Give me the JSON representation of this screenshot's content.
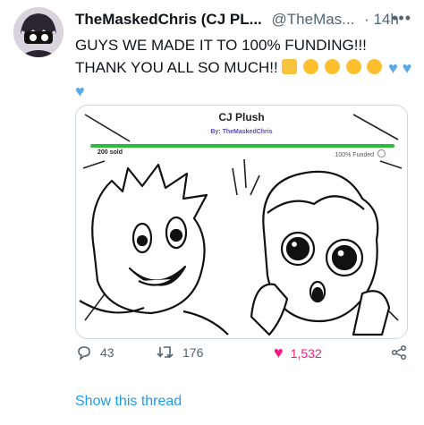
{
  "tweet": {
    "author_name": "TheMaskedChris (CJ PL...",
    "author_handle": "@TheMas...",
    "time": "· 14h",
    "line1": "GUYS WE MADE IT TO 100% FUNDING!!!",
    "line2": "THANK YOU ALL SO MUCH!!",
    "emojis": [
      "party-face",
      "loudly-crying-face",
      "loudly-crying-face",
      "loudly-crying-face",
      "pleading-face"
    ],
    "hearts_icon": "blue-heart-icon"
  },
  "media": {
    "title": "CJ Plush",
    "by": "By: TheMaskedChris",
    "sold": "200 sold",
    "funded": "100% Funded",
    "funded_progress": 1.0,
    "accent_color": "#2dbb3a"
  },
  "actions": {
    "replies": "43",
    "retweets": "176",
    "likes": "1,532",
    "like_color": "#f91880"
  },
  "show_thread": "Show this thread"
}
